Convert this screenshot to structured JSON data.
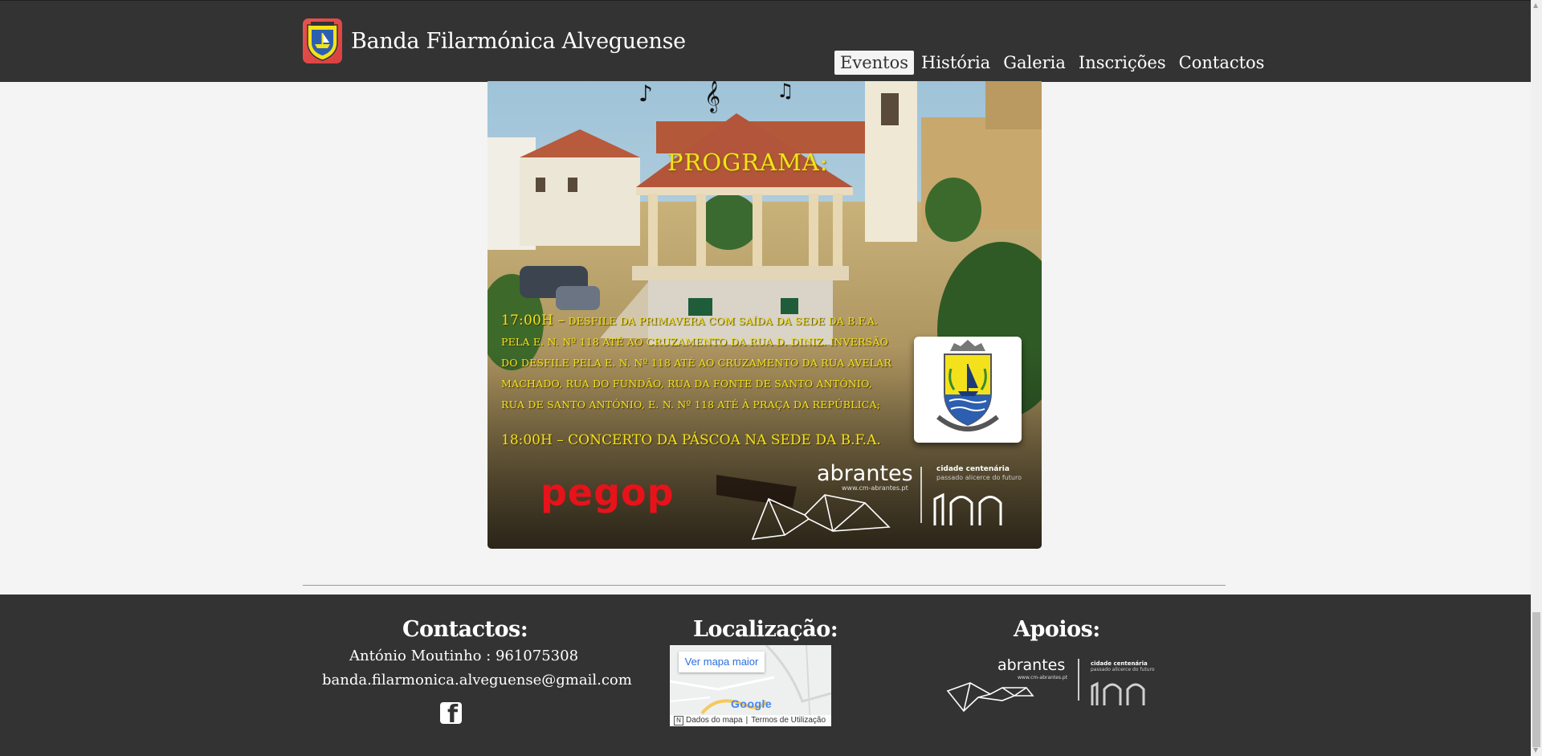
{
  "header": {
    "brand_title": "Banda Filarmónica Alveguense",
    "nav": [
      {
        "label": "Eventos",
        "active": true
      },
      {
        "label": "História"
      },
      {
        "label": "Galeria"
      },
      {
        "label": "Inscrições"
      },
      {
        "label": "Contactos"
      }
    ]
  },
  "poster": {
    "heading": "PROGRAMA:",
    "item1_time": "17:00H –",
    "item1_text": "DESFILE DA PRIMAVERA COM SAÍDA DA SEDE DA B.F.A. PELA E. N. Nº 118 ATÉ AO CRUZAMENTO DA RUA D. DINIZ. INVERSÃO DO DESFILE PELA E. N. Nº 118 ATÉ AO CRUZAMENTO DA RUA AVELAR MACHADO, RUA DO FUNDÃO, RUA DA FONTE DE SANTO ANTÓNIO, RUA DE SANTO ANTÓNIO, E. N. Nº 118 ATÉ À PRAÇA DA REPÚBLICA;",
    "item2": "18:00H – CONCERTO DA PÁSCOA NA SEDE DA B.F.A.",
    "sponsor_logo_text": "pegop",
    "abrantes_word": "abrantes",
    "abrantes_url": "www.cm-abrantes.pt",
    "centenary": "cidade centenária",
    "centenary_sub": "passado alicerce do futuro"
  },
  "footer": {
    "contacts_title": "Contactos:",
    "contact_person": "António Moutinho : 961075308",
    "contact_email": "banda.filarmonica.alveguense@gmail.com",
    "location_title": "Localização:",
    "map_button": "Ver mapa maior",
    "map_brand": "Google",
    "map_data": "Dados do mapa",
    "map_terms": "Termos de Utilização",
    "supports_title": "Apoios:",
    "supports_word": "abrantes",
    "supports_url": "www.cm-abrantes.pt",
    "supports_centenary": "cidade centenária",
    "supports_centenary_sub": "passado alicerce do futuro"
  },
  "icons": {
    "brand": "crest-icon",
    "social": "facebook-icon"
  },
  "colors": {
    "nav_bg": "#333333",
    "page_bg": "#f4f4f4",
    "poster_text": "#f3e21b",
    "pegop_red": "#e8121a"
  }
}
